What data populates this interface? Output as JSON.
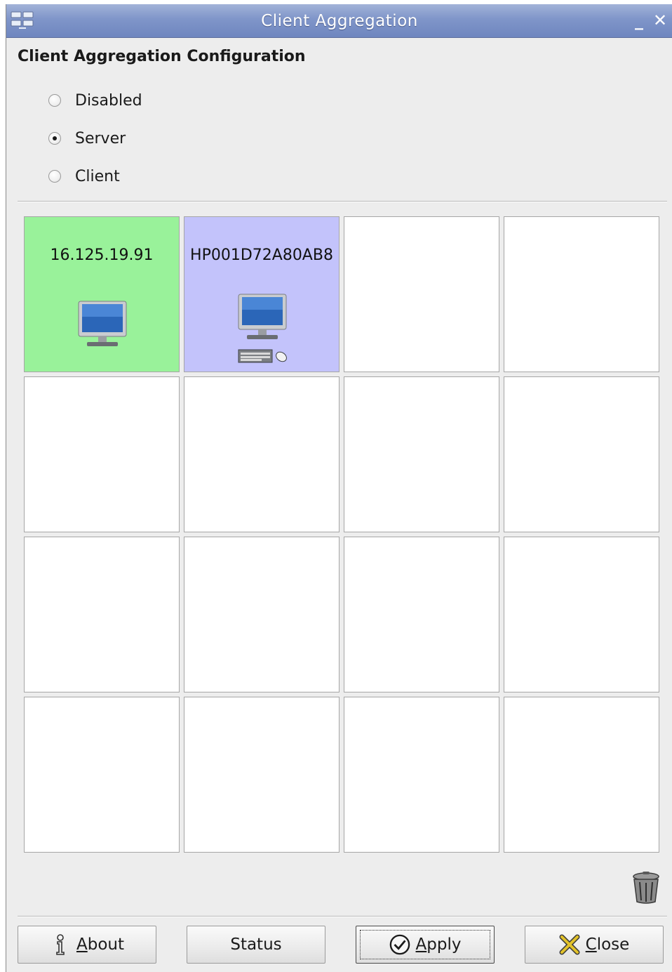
{
  "window": {
    "title": "Client Aggregation"
  },
  "config": {
    "heading": "Client Aggregation Configuration",
    "options": [
      {
        "label": "Disabled",
        "checked": false
      },
      {
        "label": "Server",
        "checked": true
      },
      {
        "label": "Client",
        "checked": false
      }
    ]
  },
  "grid": {
    "rows": 4,
    "columns": 4,
    "cells": [
      {
        "label": "16.125.19.91",
        "color": "#99f29a",
        "icons": [
          "monitor-icon"
        ]
      },
      {
        "label": "HP001D72A80AB8",
        "color": "#c3c3fb",
        "icons": [
          "monitor-icon",
          "keyboard-mouse-icon"
        ]
      }
    ]
  },
  "buttons": {
    "about": {
      "label": "About",
      "mnemonic": "A",
      "rest": "bout",
      "icon": "info-icon"
    },
    "status": {
      "label": "Status"
    },
    "apply": {
      "label": "Apply",
      "mnemonic": "A",
      "rest": "pply",
      "icon": "checkmark-icon"
    },
    "close": {
      "label": "Close",
      "mnemonic": "C",
      "rest": "lose",
      "icon": "close-x-icon"
    }
  },
  "icons": {
    "trash": "trash-icon"
  }
}
